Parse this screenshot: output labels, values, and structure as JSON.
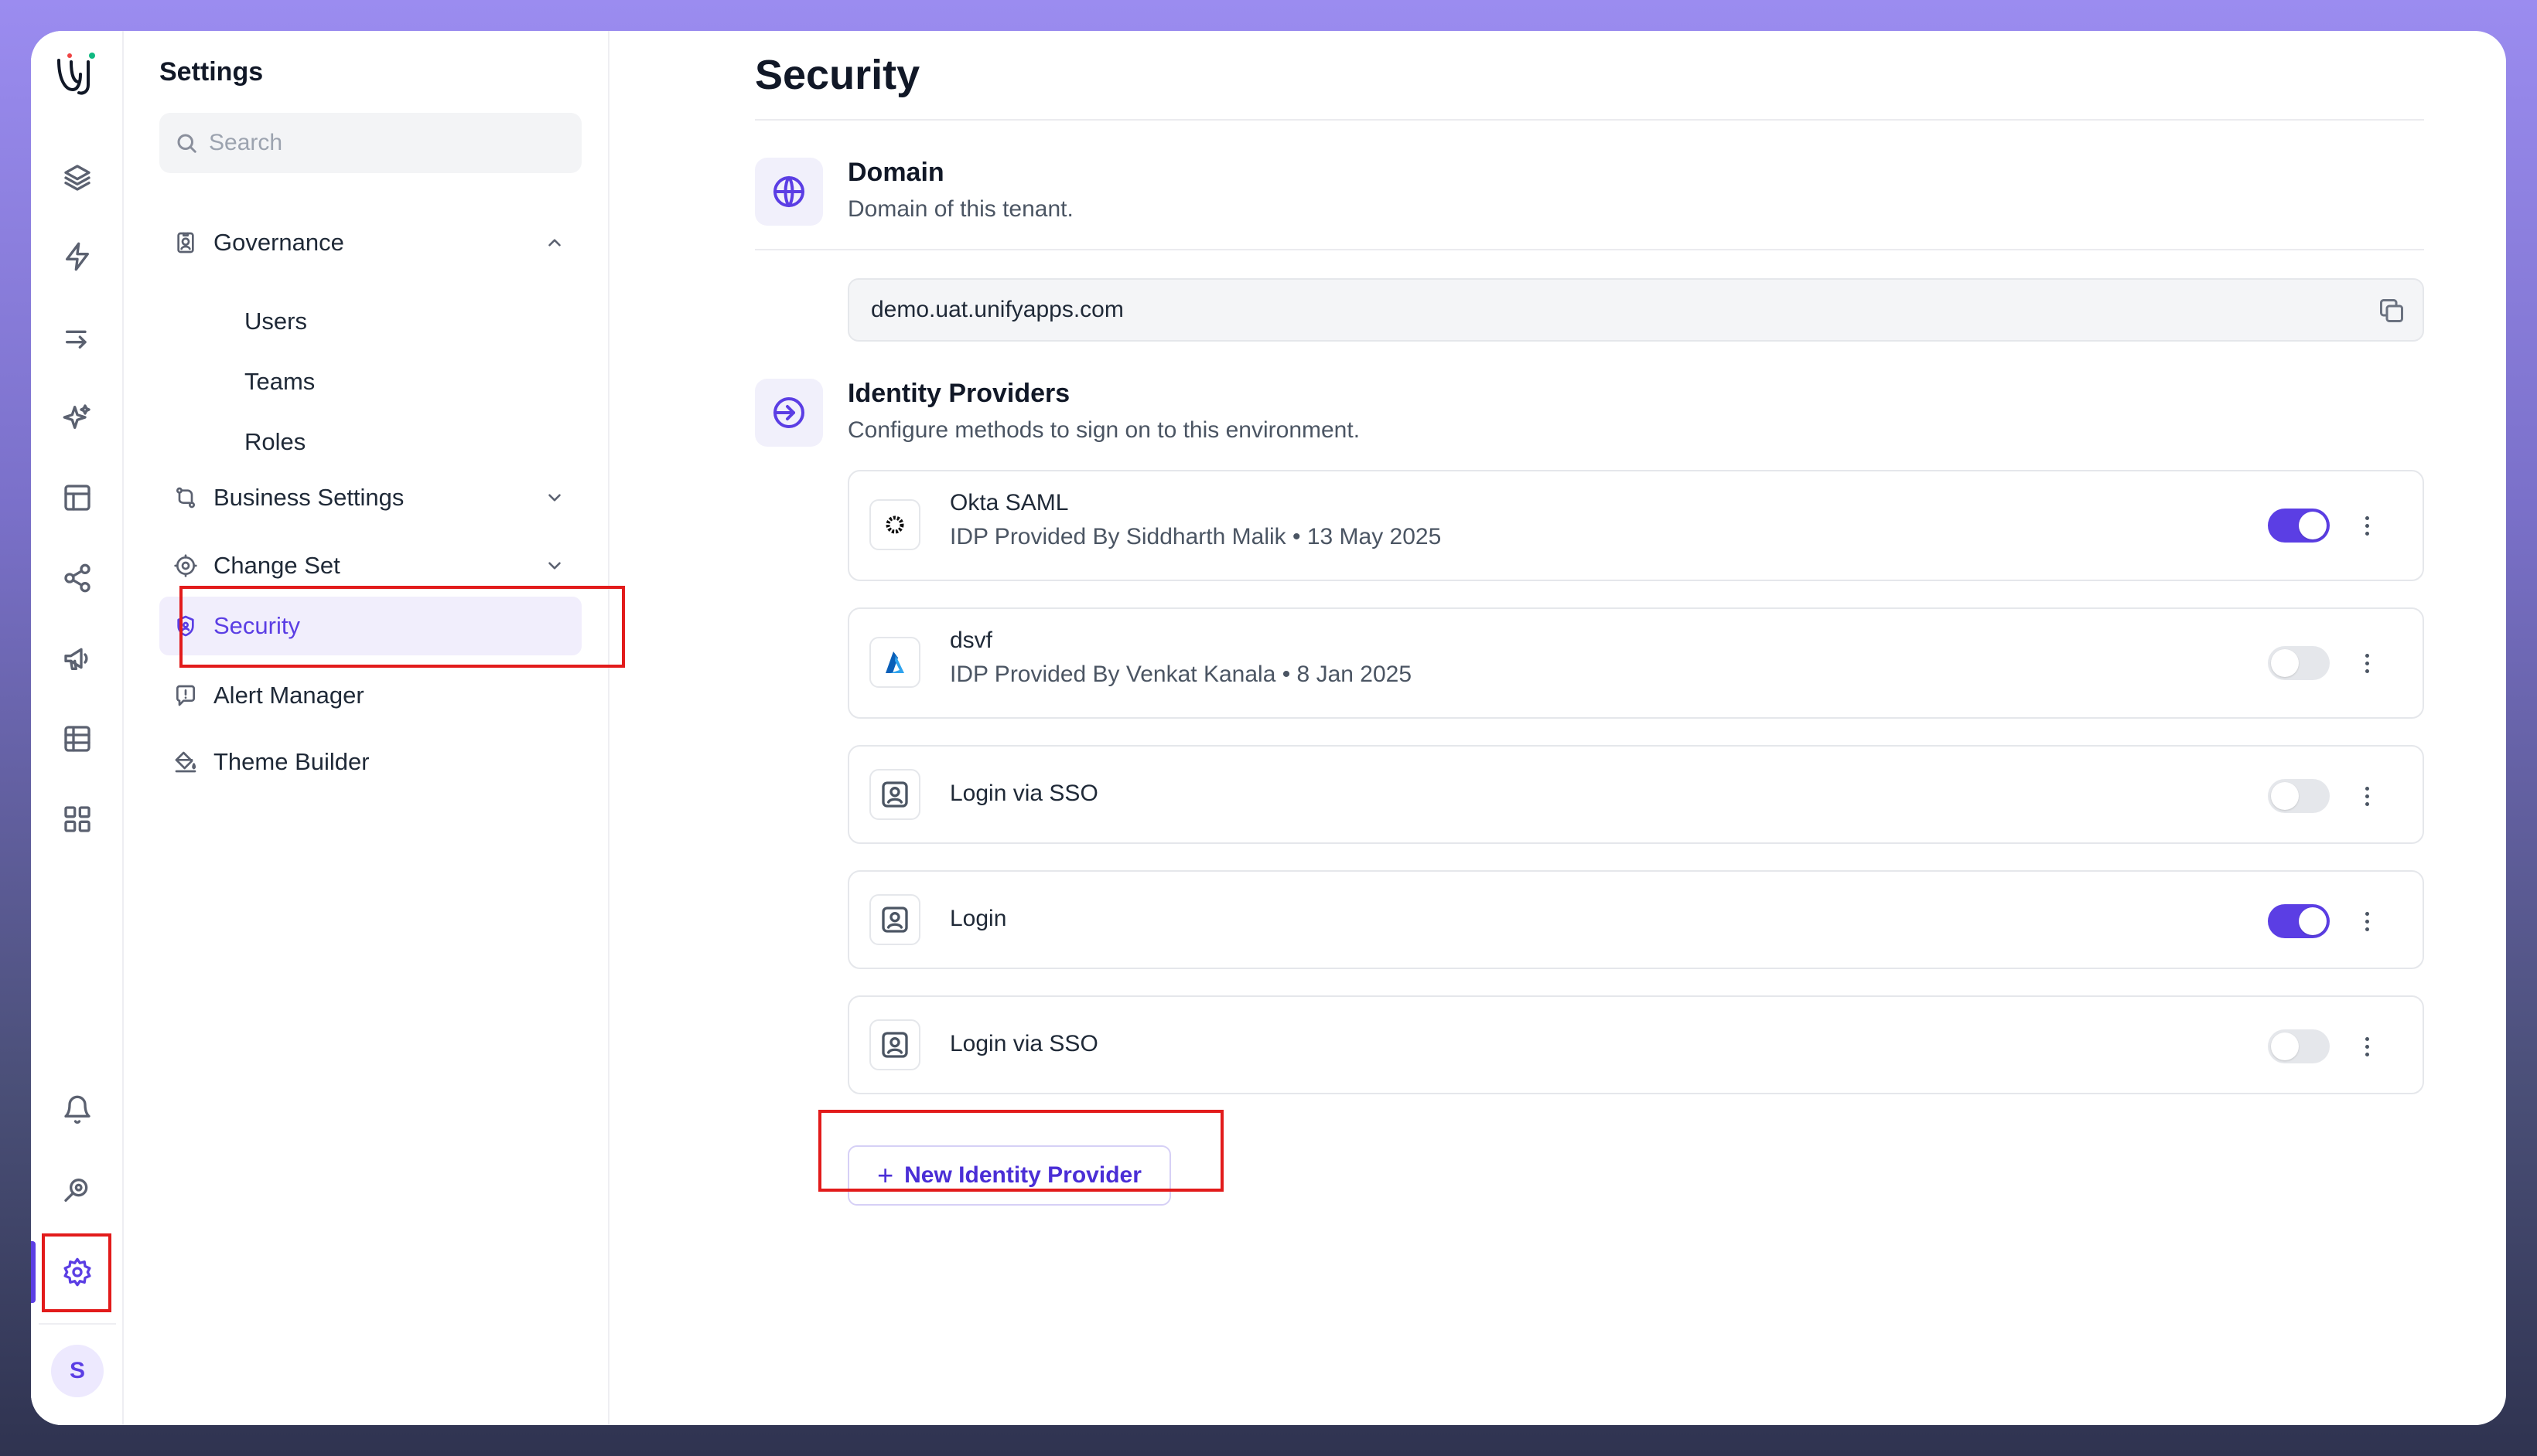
{
  "sidebar": {
    "title": "Settings",
    "search_placeholder": "Search",
    "items": [
      {
        "label": "Governance"
      },
      {
        "label": "Users"
      },
      {
        "label": "Teams"
      },
      {
        "label": "Roles"
      },
      {
        "label": "Business Settings"
      },
      {
        "label": "Change Set"
      },
      {
        "label": "Security"
      },
      {
        "label": "Alert Manager"
      },
      {
        "label": "Theme Builder"
      }
    ]
  },
  "rail": {
    "avatar_initial": "S",
    "icons": [
      "logo",
      "layers-icon",
      "lightning-icon",
      "arrow-right-icon",
      "sparkles-icon",
      "layout-icon",
      "share-icon",
      "megaphone-icon",
      "table-icon",
      "grid-icon",
      "bell-icon",
      "search-gear-icon",
      "gear-icon"
    ]
  },
  "main": {
    "title": "Security",
    "domain": {
      "title": "Domain",
      "description": "Domain of this tenant.",
      "value": "demo.uat.unifyapps.com"
    },
    "identity_providers": {
      "title": "Identity Providers",
      "description": "Configure methods to sign on to this environment.",
      "providers": [
        {
          "name": "Okta SAML",
          "meta": "IDP Provided By Siddharth Malik • 13 May 2025",
          "enabled": true,
          "icon": "okta-icon"
        },
        {
          "name": "dsvf",
          "meta": "IDP Provided By Venkat Kanala • 8 Jan 2025",
          "enabled": false,
          "icon": "azure-icon"
        },
        {
          "name": "Login via SSO",
          "meta": "",
          "enabled": false,
          "icon": "user-id-icon"
        },
        {
          "name": "Login",
          "meta": "",
          "enabled": true,
          "icon": "user-id-icon"
        },
        {
          "name": "Login via SSO",
          "meta": "",
          "enabled": false,
          "icon": "user-id-icon"
        }
      ],
      "new_button_label": "New Identity Provider"
    }
  },
  "colors": {
    "accent": "#5b3ee4",
    "highlight_box": "#e21b1b",
    "toggle_off": "#e5e7eb"
  }
}
